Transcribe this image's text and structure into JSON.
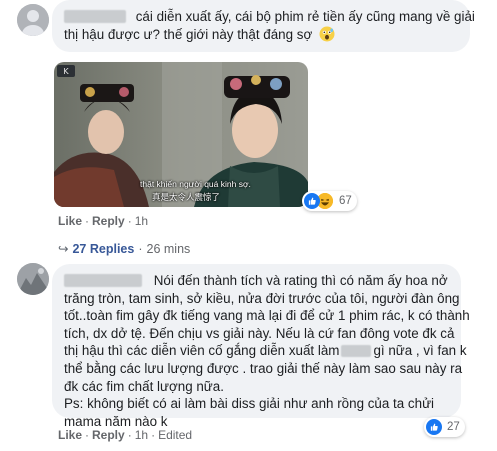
{
  "colors": {
    "bubble_bg": "#f0f2f5",
    "muted_text": "#65676b",
    "link_blue": "#385898",
    "like_blue": "#1877f2",
    "haha_yellow": "#f7b928"
  },
  "comment1": {
    "text_line1": "cái diễn xuất ấy, cái bộ phim rẻ tiền ấy cũng mang về giải",
    "text_line2": "thị hậu được ư? thế giới này thật đáng sợ",
    "emoji_icon": "scared-face-emoji",
    "photo_subtitle_vi": "thật khiến người quá kinh sợ.",
    "photo_subtitle_zh": "真是太令人震惊了",
    "actions": {
      "like": "Like",
      "reply": "Reply",
      "time": "1h"
    },
    "reactions": {
      "icons": [
        "like-icon",
        "haha-icon"
      ],
      "count": "67"
    },
    "replies": {
      "label": "27 Replies",
      "time": "26 mins"
    }
  },
  "comment2": {
    "lines": [
      "Nói đến thành tích và rating thì có năm ấy hoa nở",
      "trăng tròn, tam sinh, sở kiều, nửa đời trước của tôi, người đàn ông",
      "tốt..toàn fim gây đk tiếng vang mà lại đi để cử 1 phim rác, k có thành",
      "tích, dx dở tệ. Đến chịu vs giải này. Nếu là cứ fan đông vote đk cả",
      "thị hậu thì các diễn viên cố gắng diễn xuất làm",
      "gì nữa , vì fan k",
      "thể bằng các lưu lượng được . trao giải thế này làm sao sau này ra",
      "đk các fim chất lượng nữa.",
      "Ps: không biết có ai làm bài diss giải như anh rồng của ta chửi",
      "mama năm nào k"
    ],
    "actions": {
      "like": "Like",
      "reply": "Reply",
      "time": "1h",
      "edited": "Edited"
    },
    "reactions": {
      "icons": [
        "like-icon"
      ],
      "count": "27"
    }
  }
}
